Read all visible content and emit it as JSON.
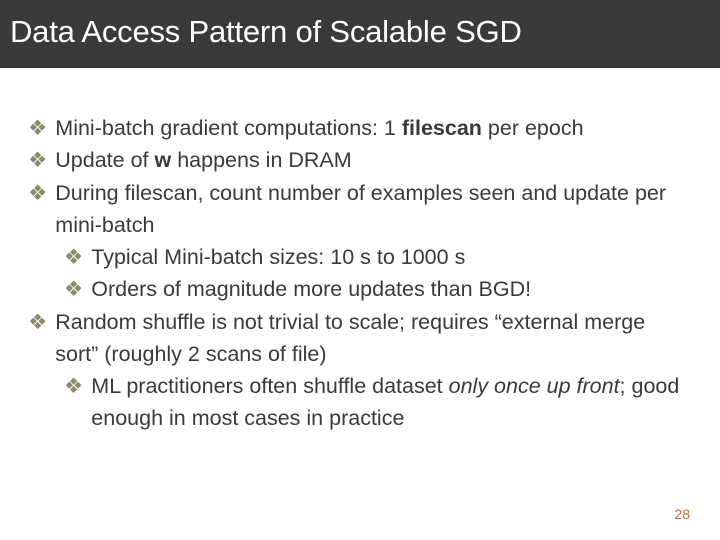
{
  "title": "Data Access Pattern of Scalable SGD",
  "bullets": [
    {
      "parts": [
        {
          "t": " Mini-batch gradient computations: 1 "
        },
        {
          "t": "filescan",
          "bold": true
        },
        {
          "t": " per epoch"
        }
      ]
    },
    {
      "parts": [
        {
          "t": "Update of "
        },
        {
          "t": "w",
          "bold": true
        },
        {
          "t": " happens in DRAM"
        }
      ]
    },
    {
      "parts": [
        {
          "t": "During filescan, count number of examples seen and update per mini-batch"
        }
      ],
      "children": [
        {
          "parts": [
            {
              "t": "Typical Mini-batch sizes: 10 s to 1000 s"
            }
          ]
        },
        {
          "parts": [
            {
              "t": "Orders of magnitude more updates than BGD!"
            }
          ]
        }
      ]
    },
    {
      "parts": [
        {
          "t": " Random shuffle is not trivial to scale; requires “external merge sort” (roughly 2 scans of file)"
        }
      ],
      "children": [
        {
          "parts": [
            {
              "t": "ML practitioners often shuffle dataset "
            },
            {
              "t": "only once up front",
              "italic": true
            },
            {
              "t": "; good enough in most cases in practice"
            }
          ]
        }
      ]
    }
  ],
  "page_number": "28",
  "glyph": "❖"
}
